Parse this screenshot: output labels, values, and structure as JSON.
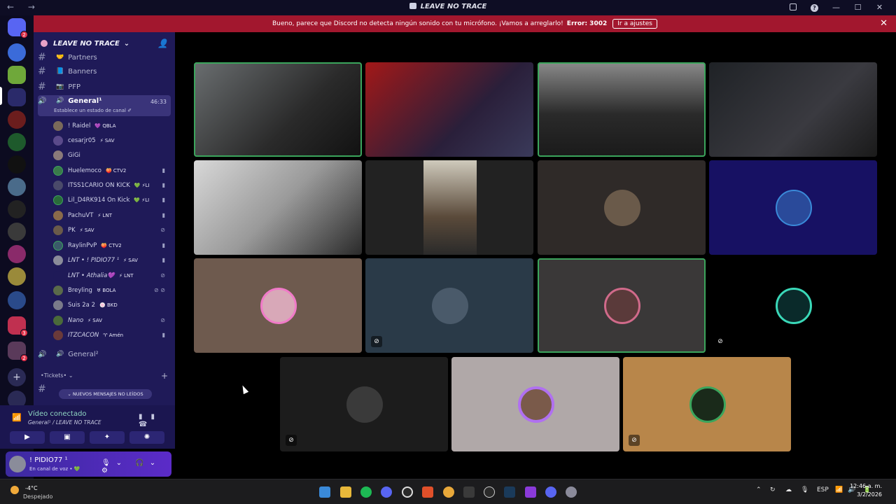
{
  "window": {
    "title": "LEAVE NO TRACE",
    "nav_arrows": "← →"
  },
  "banner": {
    "message": "Bueno, parece que Discord no detecta ningún sonido con tu micrófono. ¡Vamos a arreglarlo!",
    "error": "Error: 3002",
    "button": "Ir a ajustes",
    "close": "✕"
  },
  "server": {
    "name": "LEAVE NO TRACE"
  },
  "channels": [
    {
      "name": "Partners",
      "icon": "🤝"
    },
    {
      "name": "Banners",
      "icon": "📘"
    },
    {
      "name": "PFP",
      "icon": "📷"
    }
  ],
  "active_channel": {
    "name": "General¹",
    "icon": "🔊",
    "timer": "46:33",
    "status": "Establece un estado de canal ✐"
  },
  "voice_users": [
    {
      "name": "! Raidel",
      "tag": "💜 QBLA",
      "icon": ""
    },
    {
      "name": "cesarjr05",
      "tag": "⚡ SAV",
      "icon": ""
    },
    {
      "name": "GiGi",
      "tag": "",
      "icon": ""
    },
    {
      "name": "Huelemoco",
      "tag": "🍑 CTV2",
      "icon": "▮"
    },
    {
      "name": "ITSS1CARIO ON KICK",
      "tag": "💚 ⚡LI",
      "icon": "▮"
    },
    {
      "name": "Lil_D4RK914 On Kick",
      "tag": "💚 ⚡LI",
      "icon": "▮"
    },
    {
      "name": "PachuVT",
      "tag": "⚡ LNT",
      "icon": "▮"
    },
    {
      "name": "PK",
      "tag": "⚡ SAV",
      "icon": "⊘"
    },
    {
      "name": "RaylinPvP",
      "tag": "🍑 CTV2",
      "icon": "▮"
    },
    {
      "name": "LNT • ! PIDIO77 ¹",
      "tag": "⚡ SAV",
      "icon": "▮"
    },
    {
      "name": "LNT • Athalia💜",
      "tag": "⚡ LNT",
      "icon": "⊘"
    },
    {
      "name": "Breyling",
      "tag": "♅ BOLA",
      "icon": "⊘ ⊘"
    },
    {
      "name": "Suis 2a 2",
      "tag": "🍥 BKD",
      "icon": ""
    },
    {
      "name": "Nano",
      "tag": "⚡ SAV",
      "icon": "⊘"
    },
    {
      "name": "ITZCACON",
      "tag": "♈ Amén",
      "icon": "▮"
    }
  ],
  "other_channel": {
    "name": "General²",
    "icon": "🔊"
  },
  "category": {
    "name": "•Tickets•",
    "plus": "+"
  },
  "unread_pill": "NUEVOS MENSAJES NO LEÍDOS",
  "voice_panel": {
    "status": "Vídeo conectado",
    "channel": "General¹ / LEAVE NO TRACE"
  },
  "user_panel": {
    "name": "! PIDIO77 ¹",
    "status": "En canal de voz • 💚"
  },
  "taskbar": {
    "temp": "-4°C",
    "weather": "Despejado",
    "lang": "ESP",
    "time": "12:46 a. m.",
    "date": "3/2/2026"
  },
  "colors": {
    "accent": "#3ba55c",
    "banner": "#a2172e",
    "sidebar": "#1f1a58"
  }
}
